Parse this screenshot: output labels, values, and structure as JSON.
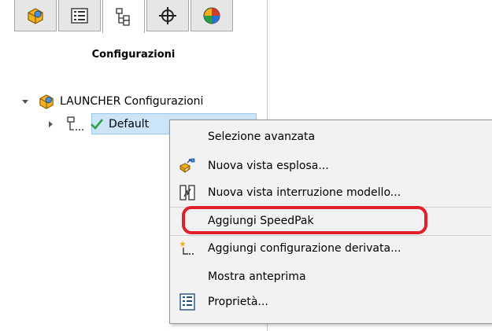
{
  "panel": {
    "title": "Configurazioni",
    "tabs": [
      {
        "icon": "part-icon"
      },
      {
        "icon": "property-manager-icon"
      },
      {
        "icon": "configuration-manager-icon",
        "active": true
      },
      {
        "icon": "dimxpert-icon"
      },
      {
        "icon": "display-manager-icon"
      }
    ]
  },
  "tree": {
    "root_label": "LAUNCHER Configurazioni",
    "child_label": "Default"
  },
  "context_menu": {
    "items": [
      {
        "label": "Selezione avanzata",
        "icon": ""
      },
      {
        "label": "Nuova vista esplosa...",
        "icon": "exploded-view-icon"
      },
      {
        "label": "Nuova vista interruzione modello...",
        "icon": "model-break-icon"
      },
      {
        "label": "Aggiungi SpeedPak",
        "icon": ""
      },
      {
        "label": "Aggiungi configurazione derivata...",
        "icon": "derived-config-icon"
      },
      {
        "label": "Mostra anteprima",
        "icon": ""
      },
      {
        "label": "Proprietà...",
        "icon": "properties-icon"
      }
    ]
  },
  "colors": {
    "highlight": "#e0202a",
    "selection": "#cce4f7",
    "checkmark": "#2ea043"
  }
}
